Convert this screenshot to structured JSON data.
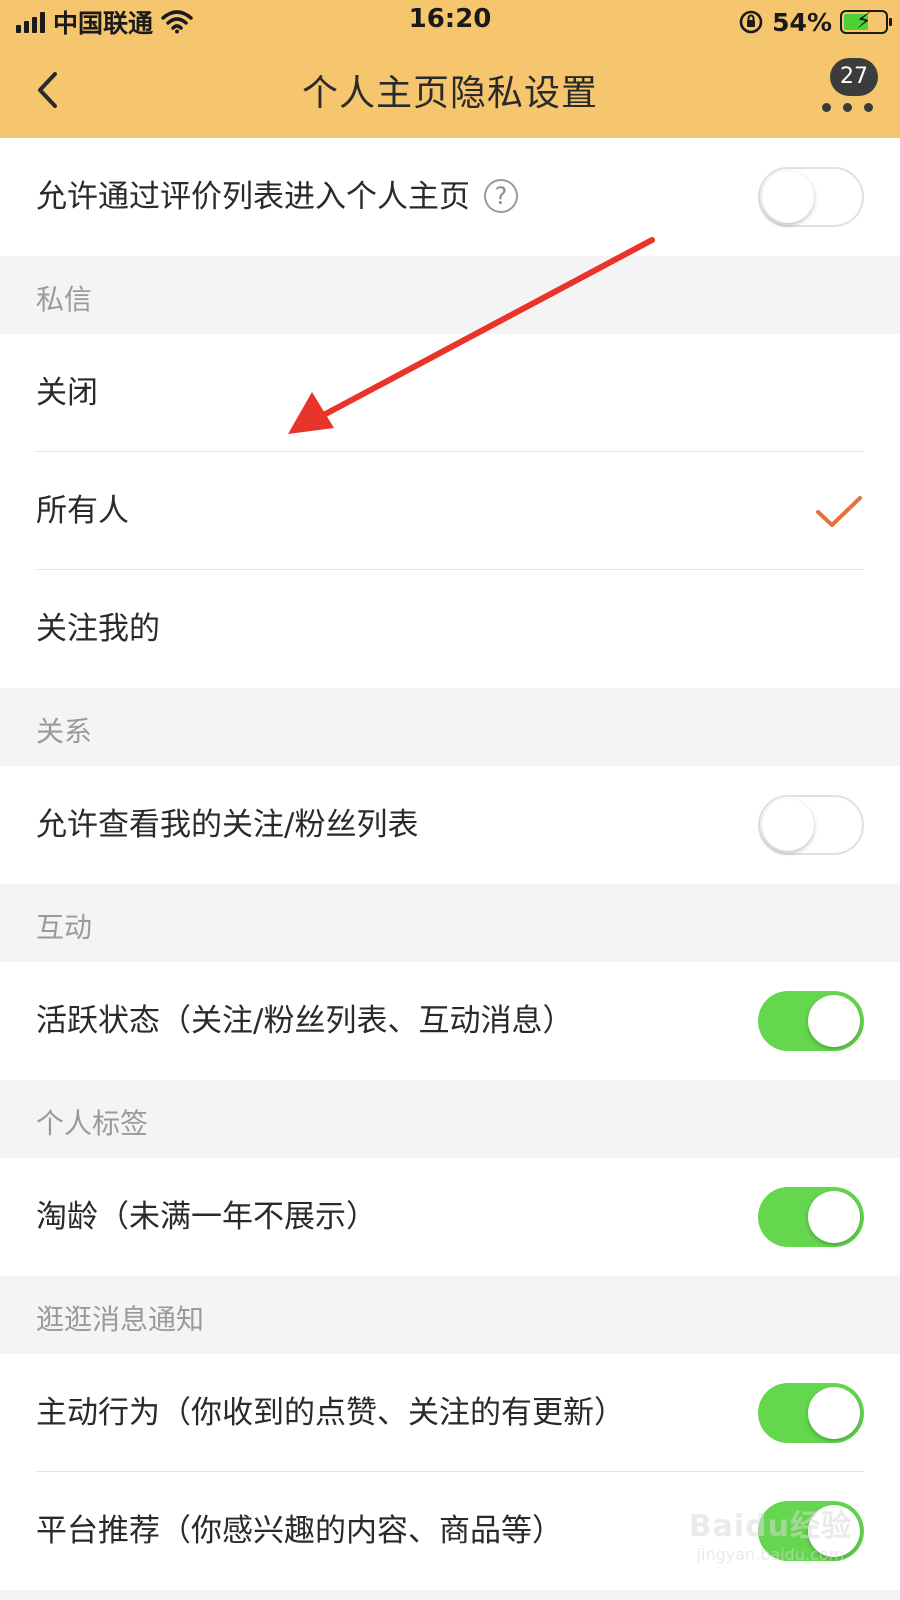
{
  "status_bar": {
    "carrier": "中国联通",
    "time": "16:20",
    "battery": "54%"
  },
  "nav": {
    "title": "个人主页隐私设置",
    "badge_count": "27"
  },
  "rows": {
    "allow_review_entry": {
      "label": "允许通过评价列表进入个人主页",
      "enabled": false
    },
    "dm_off": {
      "label": "关闭"
    },
    "dm_everyone": {
      "label": "所有人",
      "selected": true
    },
    "dm_followers": {
      "label": "关注我的"
    },
    "allow_follow_list": {
      "label": "允许查看我的关注/粉丝列表",
      "enabled": false
    },
    "active_status": {
      "label": "活跃状态（关注/粉丝列表、互动消息）",
      "enabled": true
    },
    "taobao_age": {
      "label": "淘龄（未满一年不展示）",
      "enabled": true
    },
    "active_behavior": {
      "label": "主动行为（你收到的点赞、关注的有更新）",
      "enabled": true
    },
    "platform_recommend": {
      "label": "平台推荐（你感兴趣的内容、商品等）",
      "enabled": true
    }
  },
  "sections": {
    "dm": "私信",
    "relationship": "关系",
    "interaction": "互动",
    "personal_tags": "个人标签",
    "stroll_notify": "逛逛消息通知"
  },
  "icons": {
    "back": "chevron-left-icon",
    "more": "more-dots-icon",
    "help": "question-circle-icon",
    "check": "checkmark-icon"
  },
  "colors": {
    "header_bg": "#f5c66e",
    "toggle_on": "#64d74f",
    "checkmark": "#e8703a",
    "annotation_arrow": "#e8342a"
  },
  "watermark": {
    "logo": "Baidu经验",
    "url": "jingyan.baidu.com"
  }
}
